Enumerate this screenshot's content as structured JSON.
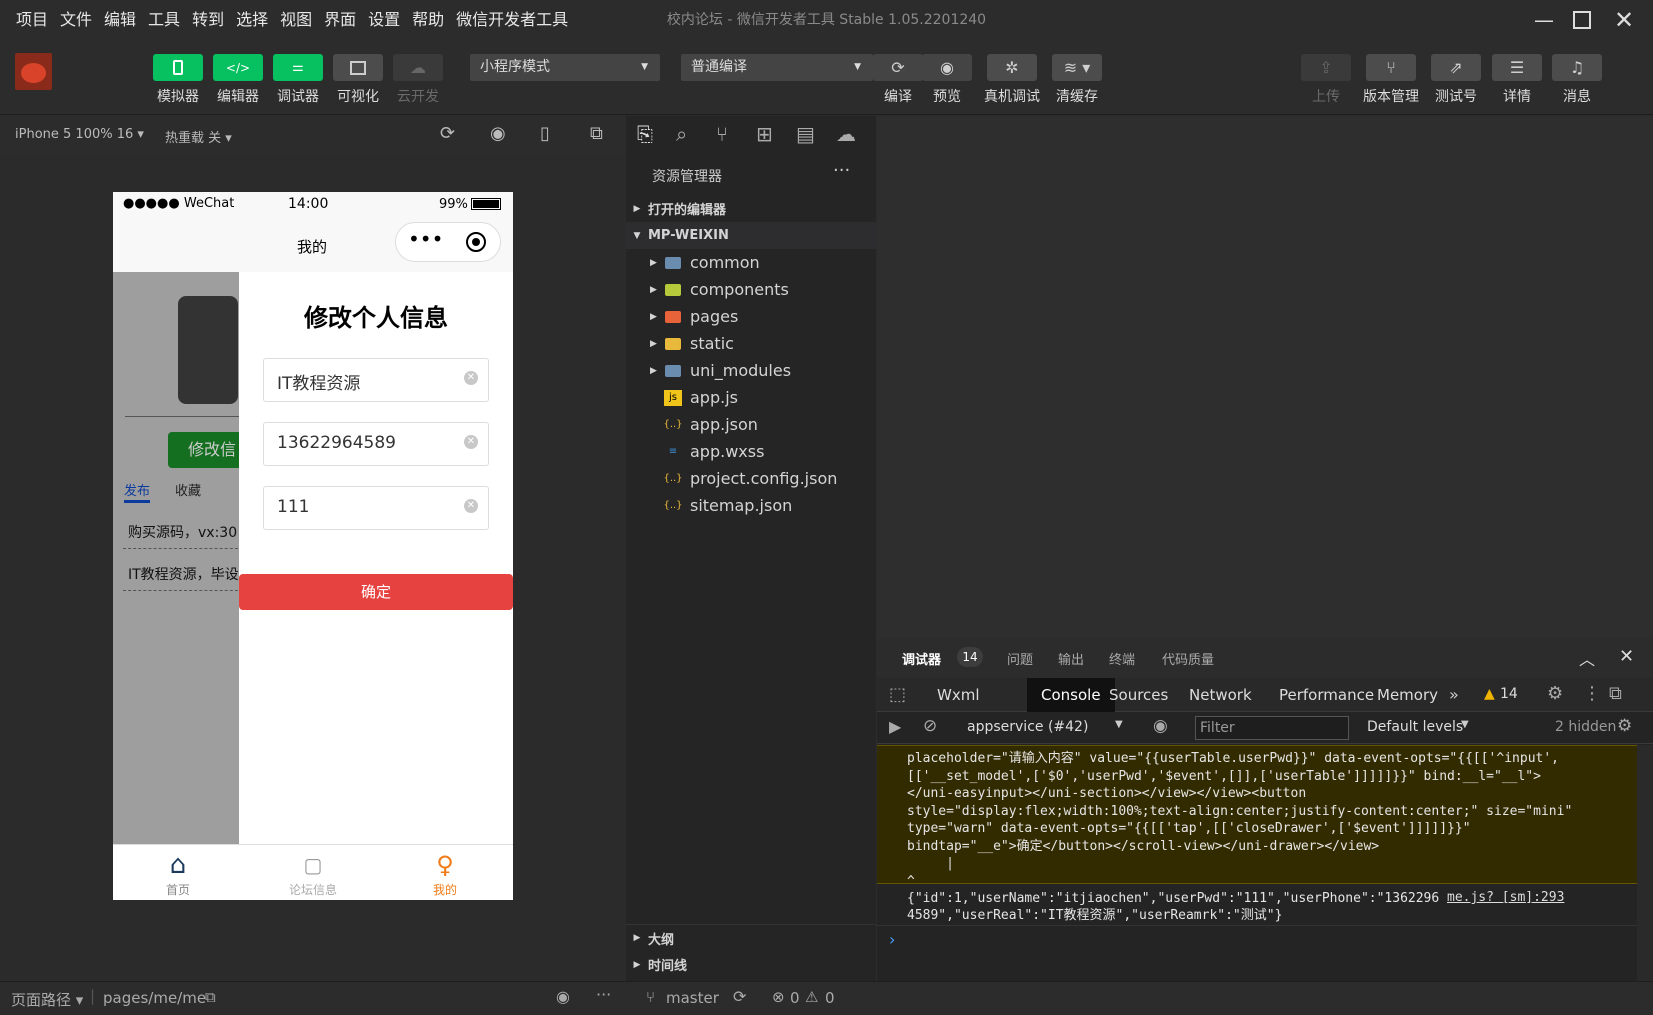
{
  "menubar": {
    "items": [
      "项目",
      "文件",
      "编辑",
      "工具",
      "转到",
      "选择",
      "视图",
      "界面",
      "设置",
      "帮助",
      "微信开发者工具"
    ]
  },
  "window": {
    "title": "校内论坛 - 微信开发者工具 Stable 1.05.2201240"
  },
  "toolbar": {
    "left_buttons": [
      {
        "label": "模拟器"
      },
      {
        "label": "编辑器"
      },
      {
        "label": "调试器"
      },
      {
        "label": "可视化"
      },
      {
        "label": "云开发"
      }
    ],
    "mode_select": "小程序模式",
    "compile_select": "普通编译",
    "mid_buttons": [
      {
        "label": "编译"
      },
      {
        "label": "预览"
      },
      {
        "label": "真机调试"
      },
      {
        "label": "清缓存"
      }
    ],
    "right_buttons": [
      {
        "label": "上传"
      },
      {
        "label": "版本管理"
      },
      {
        "label": "测试号"
      },
      {
        "label": "详情"
      },
      {
        "label": "消息"
      }
    ]
  },
  "simulator": {
    "device": "iPhone 5 100% 16",
    "hot_reload": "热重载 关",
    "status_bar": {
      "carrier": "●●●●● WeChat",
      "time": "14:00",
      "battery": "99%"
    },
    "nav_title": "我的",
    "drawer": {
      "title": "修改个人信息",
      "fields": [
        {
          "value": "IT教程资源"
        },
        {
          "value": "13622964589"
        },
        {
          "value": "111"
        }
      ],
      "confirm_button": "确定"
    },
    "behind": {
      "edit_button": "修改信",
      "tabs": [
        "发布",
        "收藏"
      ],
      "items": [
        "购买源码，vx:30",
        "IT教程资源，毕设"
      ]
    },
    "tabbar": [
      {
        "label": "首页"
      },
      {
        "label": "论坛信息"
      },
      {
        "label": "我的"
      }
    ]
  },
  "explorer": {
    "title": "资源管理器",
    "sections": [
      "打开的编辑器",
      "MP-WEIXIN"
    ],
    "folders": [
      "common",
      "components",
      "pages",
      "static",
      "uni_modules"
    ],
    "files": [
      "app.js",
      "app.json",
      "app.wxss",
      "project.config.json",
      "sitemap.json"
    ],
    "bottom_sections": [
      "大纲",
      "时间线"
    ]
  },
  "devtools": {
    "top_tabs": [
      "调试器",
      "问题",
      "输出",
      "终端",
      "代码质量"
    ],
    "badge": "14",
    "tabs": [
      "Wxml",
      "Console",
      "Sources",
      "Network",
      "Performance",
      "Memory"
    ],
    "more": "»",
    "warnings": "14",
    "context": "appservice (#42)",
    "filter_placeholder": "Filter",
    "levels": "Default levels",
    "hidden": "2 hidden",
    "console_lines": [
      "placeholder=\"请输入内容\" value=\"{{userTable.userPwd}}\" data-event-opts=\"{{[['^input',",
      "[['__set_model',['$0','userPwd','$event',[]],['userTable']]]]]}}\" bind:__l=\"__l\">",
      "</uni-easyinput></uni-section></view></view><button",
      "style=\"display:flex;width:100%;text-align:center;justify-content:center;\" size=\"mini\"",
      "type=\"warn\" data-event-opts=\"{{[['tap',[['closeDrawer',['$event']]]]]}}\"",
      "bindtap=\"__e\">确定</button></scroll-view></uni-drawer></view>",
      "     |",
      "^"
    ],
    "log_line_1": "{\"id\":1,\"userName\":\"itjiaochen\",\"userPwd\":\"111\",\"userPhone\":\"1362296",
    "log_line_2": "4589\",\"userReal\":\"IT教程资源\",\"userReamrk\":\"测试\"}",
    "log_source": "me.js? [sm]:293",
    "prompt": "›"
  },
  "statusbar": {
    "page_path_label": "页面路径",
    "page_path": "pages/me/me",
    "branch": "master",
    "errors": "0",
    "warns": "0"
  }
}
